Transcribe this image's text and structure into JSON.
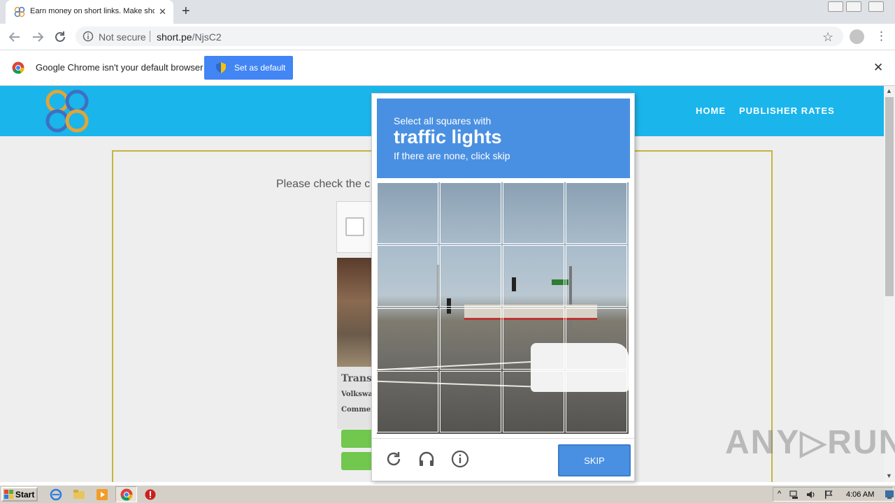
{
  "browser": {
    "tab_title": "Earn money on short links. Make sho",
    "tab_close": "✕",
    "new_tab": "+",
    "omnibox": {
      "security_label": "Not secure",
      "url_host": "short.pe",
      "url_path": "/NjsC2"
    },
    "star": "☆",
    "menu": "⋮"
  },
  "infobar": {
    "text": "Google Chrome isn't your default browser",
    "button_label": "Set as default",
    "close": "✕"
  },
  "site": {
    "nav": [
      "HOME",
      "PUBLISHER RATES"
    ],
    "please_check": "Please check the c",
    "ad": {
      "title": "Transp",
      "line1": "Volkswa",
      "line2": "Commer"
    }
  },
  "captcha": {
    "line1": "Select all squares with",
    "target": "traffic lights",
    "line3": "If there are none, click skip",
    "skip_label": "SKIP",
    "icons": [
      "reload-icon",
      "audio-icon",
      "info-icon"
    ]
  },
  "watermark": "ANY▷RUN",
  "taskbar": {
    "start_label": "Start",
    "clock": "4:06 AM"
  },
  "colors": {
    "site_header": "#1ab5ea",
    "captcha_blue": "#4a90e2",
    "chrome_button": "#4285f4",
    "ad_button": "#72c74e"
  }
}
